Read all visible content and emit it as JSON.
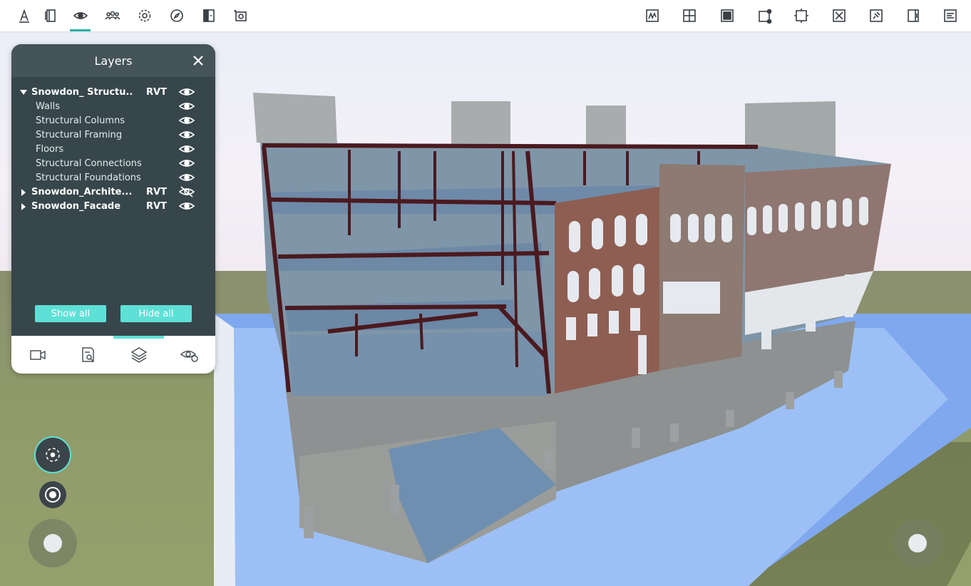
{
  "toolbar": {
    "left_tools": [
      "measure-icon",
      "section-box-icon",
      "view-icon",
      "people-icon",
      "settings-icon",
      "compass-icon",
      "door-icon",
      "camera-icon"
    ],
    "right_tools": [
      "markup-icon",
      "grid-view-icon",
      "fill-view-icon",
      "node-select-icon",
      "fit-view-icon",
      "clear-view-icon",
      "pin-icon",
      "split-view-icon",
      "properties-icon"
    ],
    "active_tool": "view-icon"
  },
  "panel": {
    "title": "Layers",
    "layers": [
      {
        "name": "Snowdon_ Structu..",
        "tag": "RVT",
        "expanded": true,
        "visible": true,
        "children": [
          "Walls",
          "Structural Columns",
          "Structural Framing",
          "Floors",
          "Structural Connections",
          "Structural Foundations"
        ]
      },
      {
        "name": "Snowdon_Archite...",
        "tag": "RVT",
        "expanded": false,
        "visible": false
      },
      {
        "name": "Snowdon_Facade",
        "tag": "RVT",
        "expanded": false,
        "visible": true
      }
    ],
    "show_all_label": "Show all",
    "hide_all_label": "Hide all",
    "tabs": [
      "camera-icon",
      "search-document-icon",
      "layers-icon",
      "visibility-settings-icon"
    ],
    "active_tab": "layers-icon"
  },
  "colors": {
    "accent": "#5ee0d6",
    "panel_bg": "#37464b",
    "panel_head": "#455459",
    "active_underline": "#28b3a5"
  }
}
